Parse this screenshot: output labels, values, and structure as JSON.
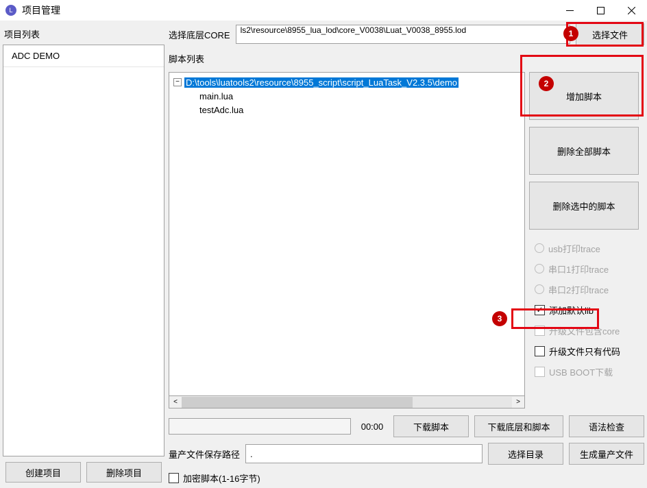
{
  "window": {
    "title": "项目管理"
  },
  "left": {
    "label": "项目列表",
    "items": [
      "ADC DEMO"
    ],
    "create_btn": "创建项目",
    "delete_btn": "删除项目"
  },
  "core": {
    "label": "选择底层CORE",
    "value": "ls2\\resource\\8955_lua_lod\\core_V0038\\Luat_V0038_8955.lod",
    "choose_btn": "选择文件"
  },
  "scripts": {
    "label": "脚本列表",
    "root": "D:\\tools\\luatools2\\resource\\8955_script\\script_LuaTask_V2.3.5\\demo",
    "files": [
      "main.lua",
      "testAdc.lua"
    ]
  },
  "side": {
    "add_script": "增加脚本",
    "delete_all": "删除全部脚本",
    "delete_selected": "删除选中的脚本",
    "radio_usb": "usb打印trace",
    "radio_s1": "串口1打印trace",
    "radio_s2": "串口2打印trace",
    "chk_add_lib": "添加默认lib",
    "chk_include_core": "升级文件包含core",
    "chk_only_code": "升级文件只有代码",
    "chk_usb_boot": "USB BOOT下载"
  },
  "bottom": {
    "timer": "00:00",
    "download_script": "下载脚本",
    "download_core_script": "下载底层和脚本",
    "syntax_check": "语法检查",
    "mass_path_label": "量产文件保存路径",
    "mass_path_value": ".",
    "choose_dir": "选择目录",
    "gen_mass": "生成量产文件",
    "encrypt_label": "加密脚本(1-16字节)"
  },
  "badges": {
    "b1": "1",
    "b2": "2",
    "b3": "3"
  }
}
